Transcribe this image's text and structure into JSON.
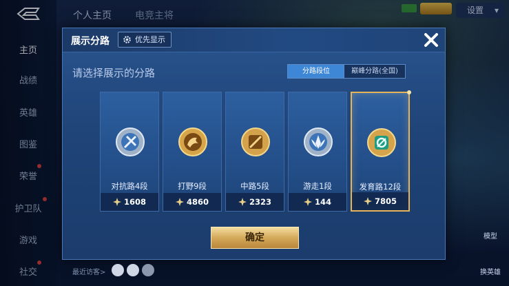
{
  "sidebar": {
    "items": [
      {
        "label": "主页"
      },
      {
        "label": "战绩"
      },
      {
        "label": "英雄"
      },
      {
        "label": "图鉴"
      },
      {
        "label": "荣誉"
      },
      {
        "label": "护卫队"
      },
      {
        "label": "游戏"
      },
      {
        "label": "社交"
      }
    ]
  },
  "topbar": {
    "tabs": [
      {
        "label": "个人主页"
      },
      {
        "label": "电竞主将"
      }
    ],
    "settings_label": "设置"
  },
  "modal": {
    "title": "展示分路",
    "priority_label": "优先显示",
    "subtitle": "请选择展示的分路",
    "segments": [
      {
        "label": "分路段位"
      },
      {
        "label": "巅峰分路(全国)"
      }
    ],
    "selected_segment": "分路段位",
    "cards": [
      {
        "label": "对抗路4段",
        "score": "1608",
        "emblem": "sword-emblem-silver"
      },
      {
        "label": "打野9段",
        "score": "4860",
        "emblem": "dragon-emblem-gold"
      },
      {
        "label": "中路5段",
        "score": "2323",
        "emblem": "mid-emblem-gold"
      },
      {
        "label": "游走1段",
        "score": "144",
        "emblem": "wing-emblem-silver"
      },
      {
        "label": "发育路12段",
        "score": "7805",
        "emblem": "adc-emblem-green"
      }
    ],
    "selected_card": "发育路12段",
    "confirm_label": "确定"
  },
  "footer": {
    "recent_visitors": "最近访客>"
  },
  "right_panel": {
    "model_label": "模型",
    "swap_label": "换英雄"
  },
  "colors": {
    "panel": "#24508b",
    "accent_blue": "#3e86d6",
    "selected_border": "#e8b45a",
    "confirm_gold": "#d4a95a"
  }
}
